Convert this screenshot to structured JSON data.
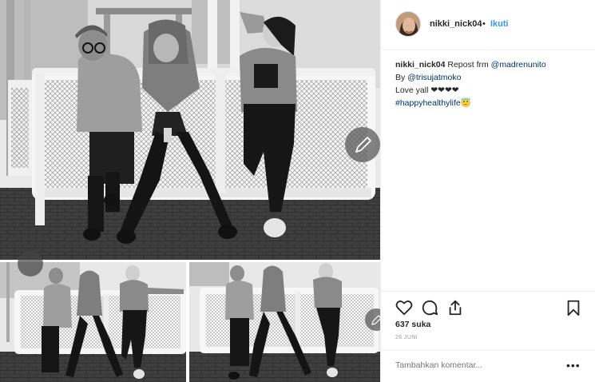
{
  "post": {
    "username": "nikki_nick04",
    "separator": "•",
    "follow_label": "Ikuti",
    "caption": {
      "username": "nikki_nick04",
      "text1": " Repost frm ",
      "mention1": "@madrenunito",
      "line2_prefix": "By ",
      "mention2": "@trisujatmoko",
      "line3": "Love yall ❤❤❤❤",
      "hashtag": "#happyhealthylife",
      "emoji": "😇"
    },
    "likes": "637 suka",
    "date": "26 JUNI",
    "comment_placeholder": "Tambahkan komentar...",
    "more_label": "•••"
  },
  "icons": {
    "like": "heart-icon",
    "comment": "comment-icon",
    "share": "share-icon",
    "save": "bookmark-icon",
    "edit": "pencil-icon"
  },
  "colors": {
    "link": "#003569",
    "follow": "#3897f0",
    "text": "#262626",
    "muted": "#999999"
  }
}
